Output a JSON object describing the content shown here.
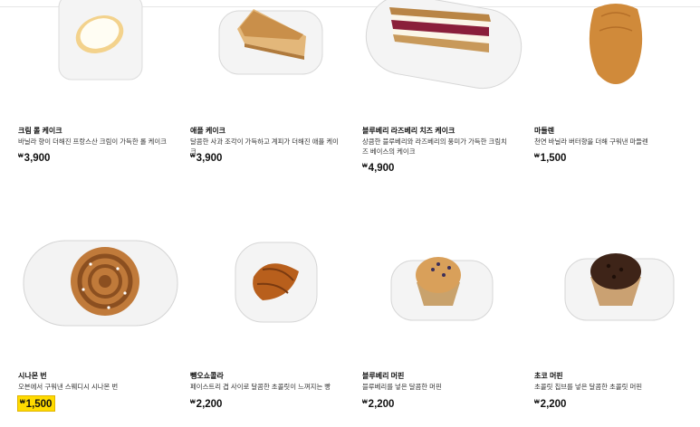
{
  "products": [
    {
      "name": "크림 롤 케이크",
      "desc": "바닐라 향이 더해진 프랑스산 크림이 가득한 롤 케이크",
      "currency": "₩",
      "price": "3,900",
      "icon": "cream-roll-cake-image"
    },
    {
      "name": "애플 케이크",
      "desc": "달콤한 사과 조각이 가득하고 계피가 더해진 애플 케이크",
      "currency": "₩",
      "price": "3,900",
      "icon": "apple-cake-image"
    },
    {
      "name": "블루베리 라즈베리 치즈 케이크",
      "desc": "상큼한 블루베리와 라즈베리의 풍미가 가득한 크림치즈 베이스의 케이크",
      "currency": "₩",
      "price": "4,900",
      "icon": "cheesecake-image"
    },
    {
      "name": "마들렌",
      "desc": "천연 바닐라 버터향을 더해 구워낸 마들렌",
      "currency": "₩",
      "price": "1,500",
      "icon": "madeleine-image"
    },
    {
      "name": "시나몬 번",
      "desc": "오븐에서 구워낸 스웨디시 시나몬 번",
      "currency": "₩",
      "price": "1,500",
      "icon": "cinnamon-bun-image",
      "highlight": true,
      "highlight_color": "#ffdb00"
    },
    {
      "name": "뺑오쇼콜라",
      "desc": "페이스트리 겹 사이로 달콤한 초콜릿이 느껴지는 빵",
      "currency": "₩",
      "price": "2,200",
      "icon": "pain-au-chocolat-image"
    },
    {
      "name": "블루베리 머핀",
      "desc": "블루베리를 넣은 달콤한 머핀",
      "currency": "₩",
      "price": "2,200",
      "icon": "blueberry-muffin-image"
    },
    {
      "name": "초코 머핀",
      "desc": "초콜릿 칩브를 넣은 달콤한 초콜릿 머핀",
      "currency": "₩",
      "price": "2,200",
      "icon": "chocolate-muffin-image"
    }
  ]
}
